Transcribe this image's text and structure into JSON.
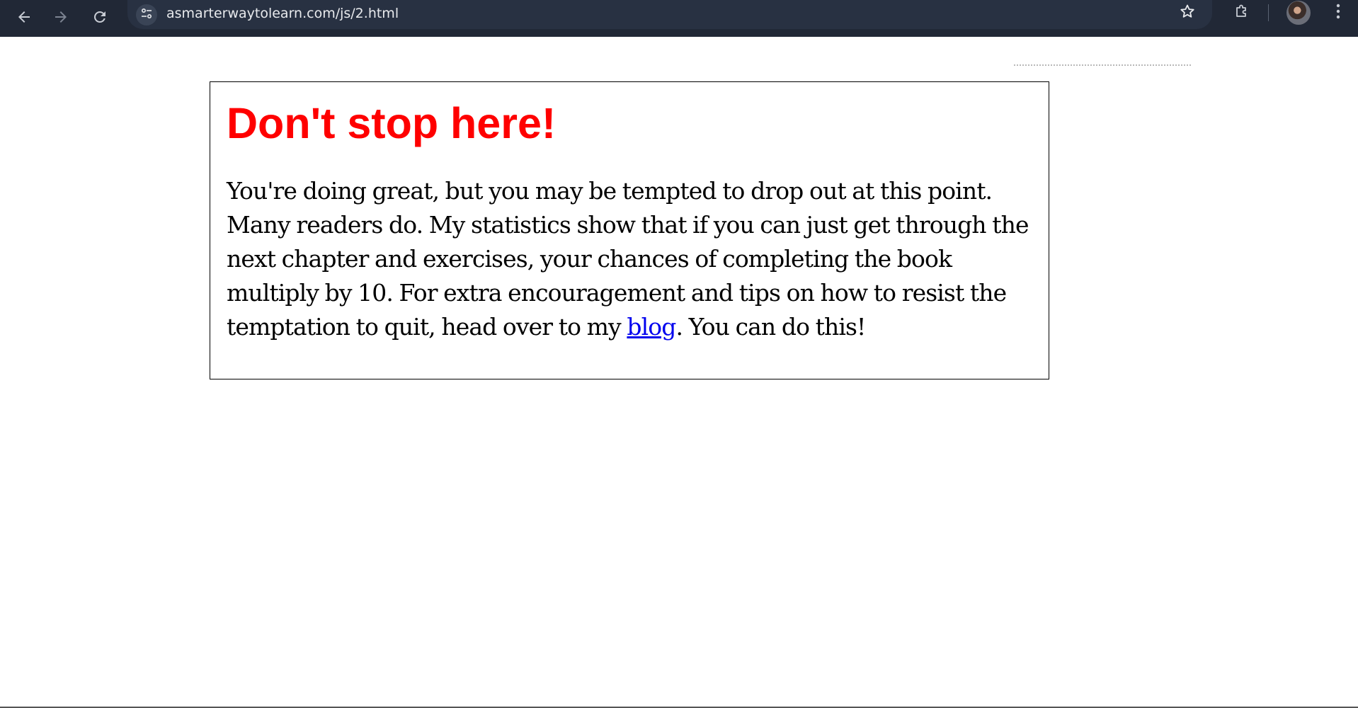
{
  "browser": {
    "url": "asmarterwaytolearn.com/js/2.html",
    "icons": {
      "back": "arrow-left-icon",
      "forward": "arrow-right-icon",
      "reload": "reload-icon",
      "site_info": "tune-icon",
      "bookmark": "star-icon",
      "extensions": "puzzle-icon",
      "menu": "kebab-menu-icon"
    }
  },
  "card": {
    "heading": "Don't stop here!",
    "lines": [
      "You're doing great, but you may be tempted to drop out at this point.",
      "Many readers do. My statistics show that if you can just get through the",
      "next chapter and exercises, your chances of completing the book",
      "multiply by 10. For extra encouragement and tips on how to resist the"
    ],
    "last_line_before_link": "temptation to quit, head over to my ",
    "link_text": "blog",
    "last_line_after_link": ". You can do this!"
  },
  "colors": {
    "heading": "#ff0000",
    "link": "#0000ee",
    "toolbar": "#212836"
  }
}
